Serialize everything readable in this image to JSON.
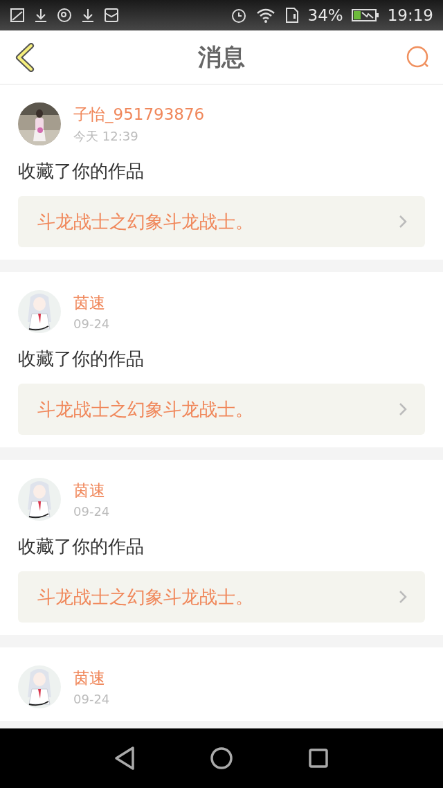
{
  "status_bar": {
    "battery": "34%",
    "time": "19:19"
  },
  "header": {
    "title": "消息"
  },
  "messages": [
    {
      "user": "子怡_951793876",
      "time": "今天 12:39",
      "action": "收藏了你的作品",
      "work": "斗龙战士之幻象斗龙战士。"
    },
    {
      "user": "茵速",
      "time": "09-24",
      "action": "收藏了你的作品",
      "work": "斗龙战士之幻象斗龙战士。"
    },
    {
      "user": "茵速",
      "time": "09-24",
      "action": "收藏了你的作品",
      "work": "斗龙战士之幻象斗龙战士。"
    },
    {
      "user": "茵速",
      "time": "09-24"
    }
  ]
}
